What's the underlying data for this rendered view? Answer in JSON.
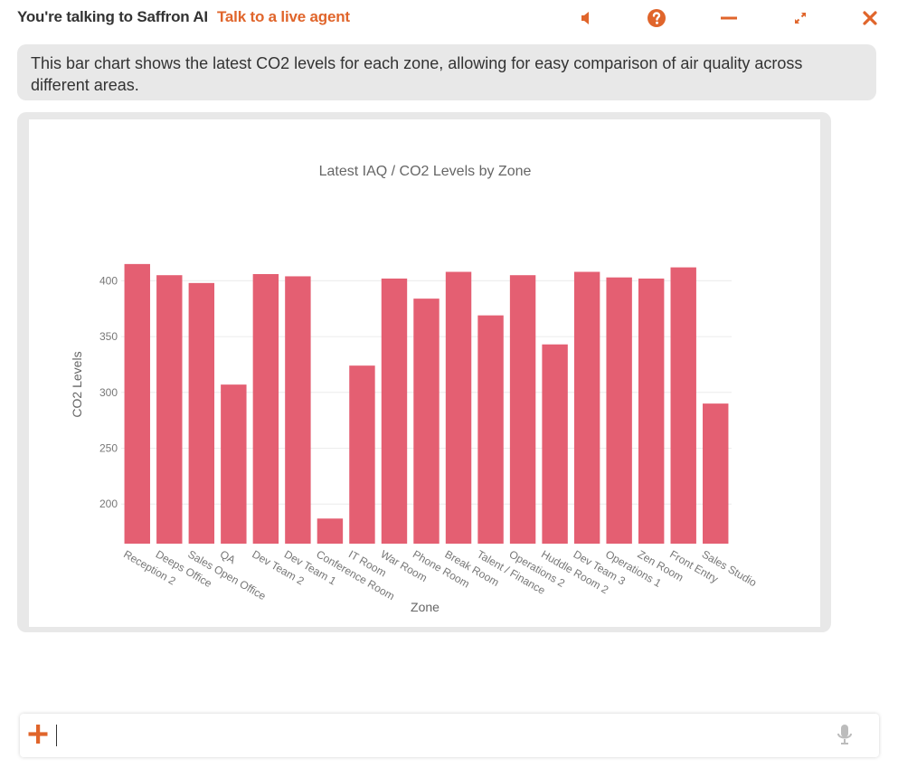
{
  "header": {
    "title": "You're talking to Saffron AI",
    "agent_link": "Talk to a live agent",
    "icons": [
      "speaker-icon",
      "help-icon",
      "minimize-icon",
      "expand-icon",
      "close-icon"
    ],
    "accent_color": "#e0652b"
  },
  "message": {
    "text": "This bar chart shows the latest CO2 levels for each zone, allowing for easy comparison of air quality across different areas."
  },
  "chart_data": {
    "type": "bar",
    "title": "Latest IAQ / CO2 Levels by Zone",
    "xlabel": "Zone",
    "ylabel": "CO2 Levels",
    "ylim": [
      164.5,
      423
    ],
    "yticks": [
      200,
      250,
      300,
      350,
      400
    ],
    "grid": true,
    "bar_color": "#e45f72",
    "categories": [
      "Reception 2",
      "Deeps Office",
      "Sales Open Office",
      "QA",
      "Dev Team 2",
      "Dev Team 1",
      "Conference Room",
      "IT Room",
      "War Room",
      "Phone Room",
      "Break Room",
      "Talent / Finance",
      "Operations 2",
      "Huddle Room 2",
      "Dev Team 3",
      "Operations 1",
      "Zen Room",
      "Front Entry",
      "Sales Studio"
    ],
    "values": [
      415,
      405,
      398,
      307,
      406,
      404,
      187,
      324,
      402,
      384,
      408,
      369,
      405,
      343,
      408,
      403,
      402,
      412,
      290
    ]
  },
  "input": {
    "value": "",
    "placeholder": ""
  }
}
